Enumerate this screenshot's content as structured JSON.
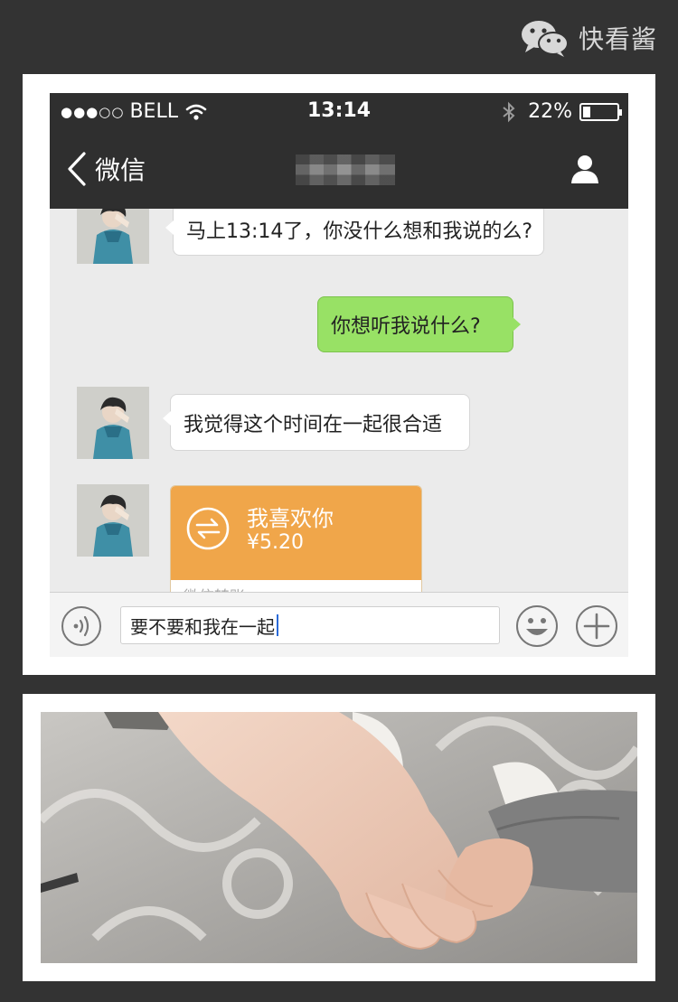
{
  "watermark": {
    "icon": "wechat-logo-icon",
    "text": "快看酱"
  },
  "status_bar": {
    "signal": "●●●○○",
    "carrier": "BELL",
    "wifi_icon": "wifi-icon",
    "time": "13:14",
    "bluetooth_icon": "bluetooth-icon",
    "battery_percent": "22%",
    "battery_level": 0.22
  },
  "nav": {
    "back_label": "微信",
    "back_icon": "chevron-left-icon",
    "contact_name": "",
    "profile_icon": "person-icon"
  },
  "messages": [
    {
      "side": "left",
      "text": "马上13:14了，你没什么想和我说的么?"
    },
    {
      "side": "right",
      "text": "你想听我说什么?"
    },
    {
      "side": "left",
      "text": "我觉得这个时间在一起很合适"
    }
  ],
  "transfer": {
    "icon": "transfer-arrows-icon",
    "note": "我喜欢你",
    "amount": "¥5.20",
    "footer": "微信转账"
  },
  "input": {
    "value": "要不要和我在一起",
    "voice_icon": "voice-icon",
    "emoji_icon": "smiley-icon",
    "plus_icon": "plus-icon"
  },
  "colors": {
    "outer_bg": "#333333",
    "bar_bg": "#2f2f2f",
    "sent_bubble": "#98e165",
    "transfer_orange": "#f0a64a"
  }
}
